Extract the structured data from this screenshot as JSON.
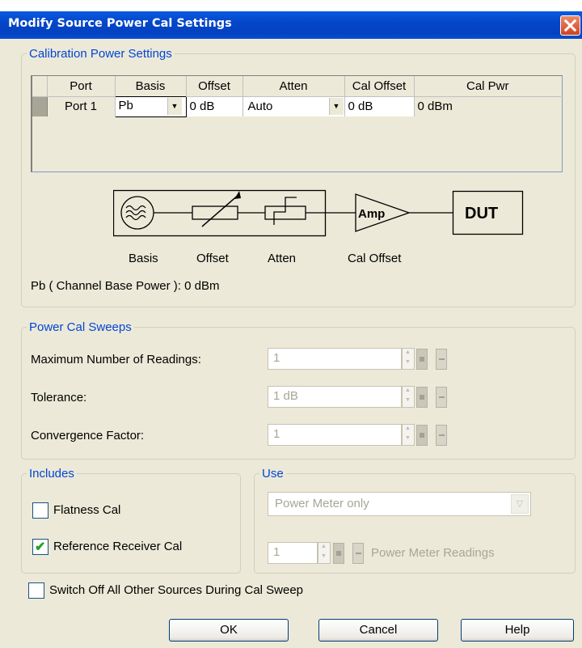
{
  "window": {
    "title": "Modify Source Power Cal Settings"
  },
  "cal_power": {
    "legend": "Calibration Power Settings",
    "table": {
      "headers": [
        "Port",
        "Basis",
        "Offset",
        "Atten",
        "Cal Offset",
        "Cal Pwr"
      ],
      "row": {
        "port": "Port 1",
        "basis": "Pb",
        "offset": "0 dB",
        "atten": "Auto",
        "cal_offset": "0 dB",
        "cal_pwr": "0 dBm"
      }
    },
    "diagram": {
      "amp_label": "Amp",
      "dut_label": "DUT",
      "labels": [
        "Basis",
        "Offset",
        "Atten",
        "Cal Offset"
      ]
    },
    "base_power_text": "Pb ( Channel Base Power ): 0 dBm"
  },
  "sweeps": {
    "legend": "Power Cal Sweeps",
    "max_readings_label": "Maximum Number of Readings:",
    "max_readings_value": "1",
    "tolerance_label": "Tolerance:",
    "tolerance_value": "1 dB",
    "convergence_label": "Convergence Factor:",
    "convergence_value": "1"
  },
  "includes": {
    "legend": "Includes",
    "flatness_label": "Flatness Cal",
    "flatness_checked": false,
    "reference_label": "Reference Receiver Cal",
    "reference_checked": true
  },
  "use": {
    "legend": "Use",
    "selected": "Power Meter only",
    "readings_value": "1",
    "readings_label": "Power Meter Readings"
  },
  "switch_off_label": "Switch Off All Other Sources During Cal Sweep",
  "buttons": {
    "ok": "OK",
    "cancel": "Cancel",
    "help": "Help"
  },
  "colors": {
    "titlebar": "#0446c9",
    "legend": "#0046d5",
    "dialog_bg": "#ece9d8"
  }
}
